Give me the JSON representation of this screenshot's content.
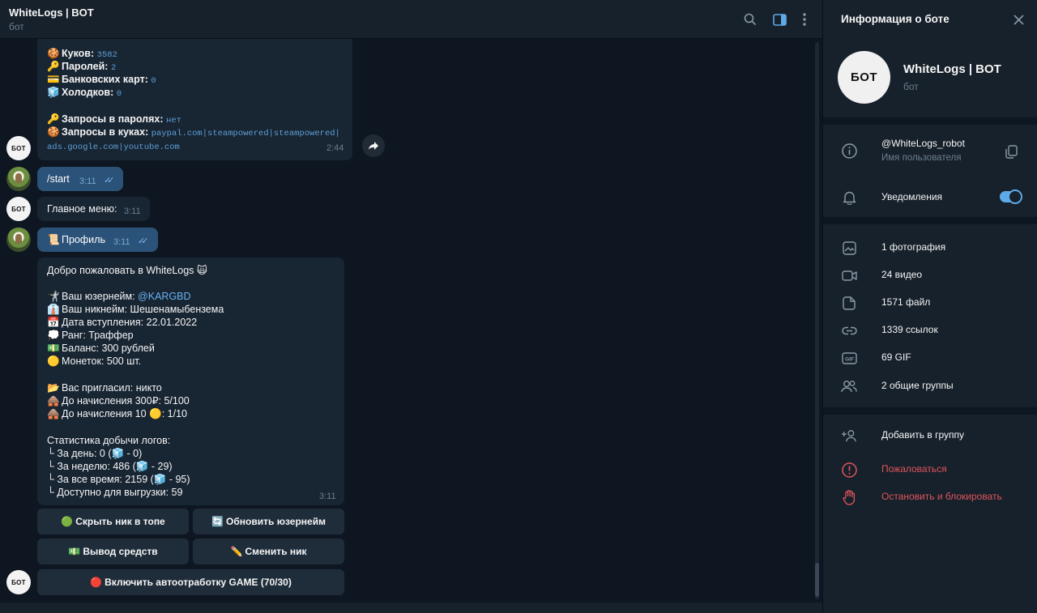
{
  "header": {
    "title": "WhiteLogs | BOT",
    "subtitle": "бот"
  },
  "msg_top": {
    "lines": [
      {
        "emoji": "🍪",
        "label": "Куков: ",
        "value": "3582"
      },
      {
        "emoji": "🔑",
        "label": "Паролей: ",
        "value": "2"
      },
      {
        "emoji": "💳",
        "label": "Банковских карт: ",
        "value": "0"
      },
      {
        "emoji": "🧊",
        "label": "Холодков: ",
        "value": "0"
      }
    ],
    "req_pass_label": "Запросы в паролях: ",
    "req_pass_value": "нет",
    "req_cookie_label": "Запросы в куках: ",
    "req_cookie_value": "paypal.com|steampowered|steampowered|",
    "req_cookie_value2": "ads.google.com|youtube.com",
    "time": "2:44"
  },
  "msg_start": {
    "text": "/start",
    "time": "3:11"
  },
  "msg_menu": {
    "text": "Главное меню:",
    "time": "3:11"
  },
  "msg_profile": {
    "text": "Профиль",
    "time": "3:11"
  },
  "msg_welcome": {
    "title": "Добро пожаловать в WhiteLogs",
    "username_label": "Ваш юзернейм: ",
    "username_value": "@KARGBD",
    "nickname": "Ваш никнейм: Шешенамыбензема",
    "joined": "Дата вступления: 22.01.2022",
    "rank": "Ранг: Траффер",
    "balance": "Баланс: 300 рублей",
    "coins": "Монеток: 500 шт.",
    "invited": "Вас пригласил: никто",
    "until_rub": "До начисления 300₽: 5/100",
    "until_coin_a": "До начисления 10",
    "until_coin_b": ": 1/10",
    "stats_title": "Статистика добычи логов:",
    "stat_day_a": "└ За день: 0 (",
    "stat_day_b": " - 0)",
    "stat_week_a": "└ За неделю: 486 (",
    "stat_week_b": " - 29)",
    "stat_all_a": "└ За все время: 2159 (",
    "stat_all_b": " - 95)",
    "stat_available": "└ Доступно для выгрузки: 59",
    "time": "3:11"
  },
  "keyboard": {
    "hide_nick": "Скрыть ник в топе",
    "update_username": "Обновить юзернейм",
    "withdraw": "Вывод средств",
    "change_nick": "Сменить ник",
    "autofarm": "Включить автоотработку GAME (70/30)"
  },
  "avatar_text": "БОТ",
  "panel": {
    "title": "Информация о боте",
    "name": "WhiteLogs | BOT",
    "sub": "бот",
    "username": "@WhiteLogs_robot",
    "username_caption": "Имя пользователя",
    "notifications": "Уведомления",
    "media": [
      {
        "icon": "photo-icon",
        "label": "1 фотография"
      },
      {
        "icon": "video-icon",
        "label": "24 видео"
      },
      {
        "icon": "file-icon",
        "label": "1571 файл"
      },
      {
        "icon": "link-icon",
        "label": "1339 ссылок"
      },
      {
        "icon": "gif-icon",
        "label": "69 GIF"
      },
      {
        "icon": "groups-icon",
        "label": "2 общие группы"
      }
    ],
    "add_to_group": "Добавить в группу",
    "report": "Пожаловаться",
    "block": "Остановить и блокировать"
  },
  "colors": {
    "bg": "#0e1621",
    "panel": "#17212b",
    "bubble_in": "#182533",
    "bubble_out": "#2b5278",
    "accent": "#5ea9e7",
    "danger": "#e0545a"
  }
}
